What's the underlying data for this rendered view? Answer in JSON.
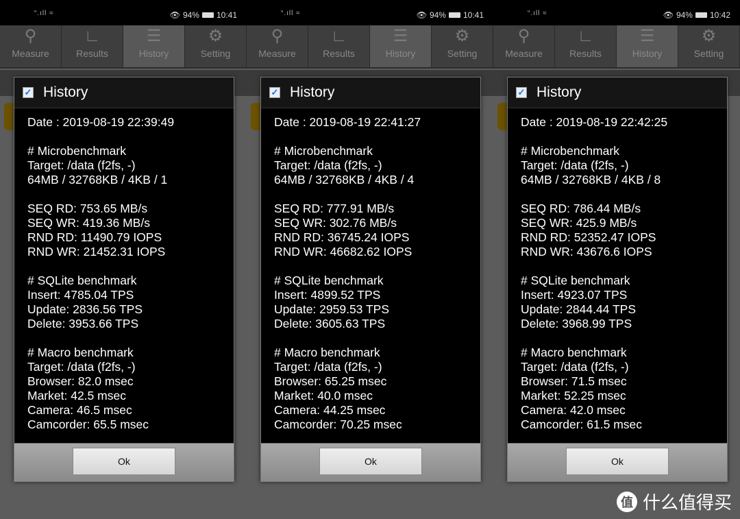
{
  "tabs": [
    {
      "label": "Measure",
      "icon": "search-icon"
    },
    {
      "label": "Results",
      "icon": "chart-icon"
    },
    {
      "label": "History",
      "icon": "list-icon"
    },
    {
      "label": "Setting",
      "icon": "gear-icon"
    }
  ],
  "dialog_title": "History",
  "ok_label": "Ok",
  "watermark": "什么值得买",
  "watermark_logo": "值",
  "panels": [
    {
      "status": {
        "battery": "94%",
        "time": "10:41"
      },
      "lines": [
        "Date : 2019-08-19 22:39:49",
        "",
        "# Microbenchmark",
        "Target: /data (f2fs, -)",
        "64MB / 32768KB / 4KB / 1",
        "",
        "SEQ RD: 753.65 MB/s",
        "SEQ WR: 419.36 MB/s",
        "RND RD: 11490.79 IOPS",
        "RND WR: 21452.31 IOPS",
        "",
        "# SQLite benchmark",
        "Insert: 4785.04 TPS",
        "Update: 2836.56 TPS",
        "Delete: 3953.66 TPS",
        "",
        "# Macro benchmark",
        "Target: /data (f2fs, -)",
        "Browser: 82.0 msec",
        "Market: 42.5 msec",
        "Camera: 46.5 msec",
        "Camcorder: 65.5 msec"
      ]
    },
    {
      "status": {
        "battery": "94%",
        "time": "10:41"
      },
      "lines": [
        "Date : 2019-08-19 22:41:27",
        "",
        "# Microbenchmark",
        "Target: /data (f2fs, -)",
        "64MB / 32768KB / 4KB / 4",
        "",
        "SEQ RD: 777.91 MB/s",
        "SEQ WR: 302.76 MB/s",
        "RND RD: 36745.24 IOPS",
        "RND WR: 46682.62 IOPS",
        "",
        "# SQLite benchmark",
        "Insert: 4899.52 TPS",
        "Update: 2959.53 TPS",
        "Delete: 3605.63 TPS",
        "",
        "# Macro benchmark",
        "Target: /data (f2fs, -)",
        "Browser: 65.25 msec",
        "Market: 40.0 msec",
        "Camera: 44.25 msec",
        "Camcorder: 70.25 msec"
      ]
    },
    {
      "status": {
        "battery": "94%",
        "time": "10:42"
      },
      "lines": [
        "Date : 2019-08-19 22:42:25",
        "",
        "# Microbenchmark",
        "Target: /data (f2fs, -)",
        "64MB / 32768KB / 4KB / 8",
        "",
        "SEQ RD: 786.44 MB/s",
        "SEQ WR: 425.9 MB/s",
        "RND RD: 52352.47 IOPS",
        "RND WR: 43676.6 IOPS",
        "",
        "# SQLite benchmark",
        "Insert: 4923.07 TPS",
        "Update: 2844.44 TPS",
        "Delete: 3968.99 TPS",
        "",
        "# Macro benchmark",
        "Target: /data (f2fs, -)",
        "Browser: 71.5 msec",
        "Market: 52.25 msec",
        "Camera: 42.0 msec",
        "Camcorder: 61.5 msec"
      ]
    }
  ]
}
